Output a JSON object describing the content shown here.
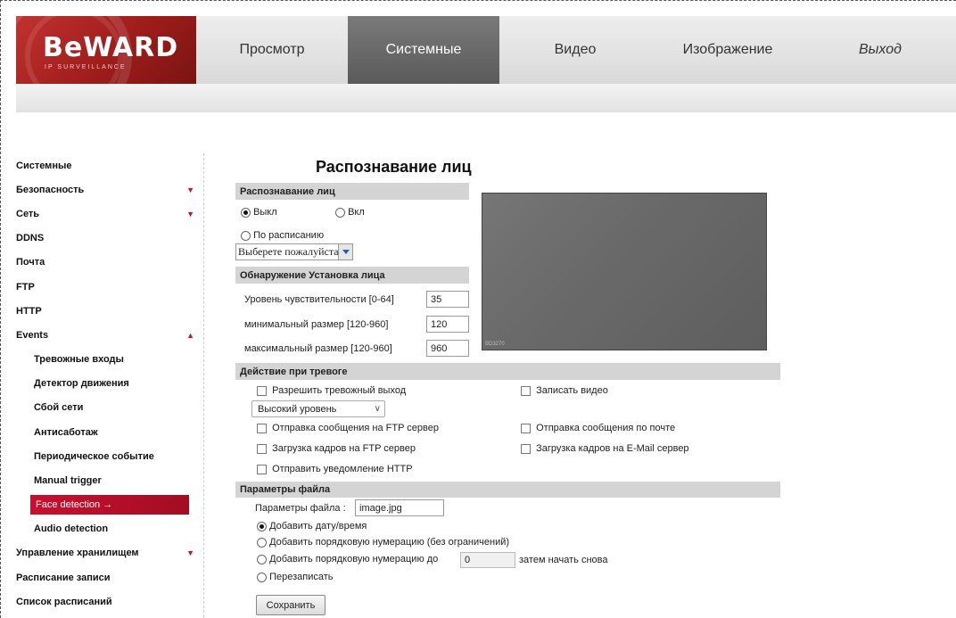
{
  "logo": {
    "brand": "BeWARD",
    "tagline": "IP SURVEILLANCE"
  },
  "topnav": [
    {
      "label": "Просмотр",
      "active": false
    },
    {
      "label": "Системные",
      "active": true
    },
    {
      "label": "Видео",
      "active": false
    },
    {
      "label": "Изображение",
      "active": false
    },
    {
      "label": "Выход",
      "active": false
    }
  ],
  "sidebar": {
    "items": [
      {
        "label": "Системные"
      },
      {
        "label": "Безопасность"
      },
      {
        "label": "Сеть"
      },
      {
        "label": "DDNS"
      },
      {
        "label": "Почта"
      },
      {
        "label": "FTP"
      },
      {
        "label": "HTTP"
      },
      {
        "label": "Events"
      },
      {
        "label": "Тревожные входы"
      },
      {
        "label": "Детектор движения"
      },
      {
        "label": "Сбой сети"
      },
      {
        "label": "Антисаботаж"
      },
      {
        "label": "Периодическое событие"
      },
      {
        "label": "Manual trigger"
      },
      {
        "label": "Face detection →"
      },
      {
        "label": "Audio detection"
      },
      {
        "label": "Управление хранилищем"
      },
      {
        "label": "Расписание записи"
      },
      {
        "label": "Список расписаний"
      }
    ],
    "arrow_down": "▼",
    "arrow_up": "▲"
  },
  "main": {
    "title": "Распознавание лиц",
    "section_face": {
      "header": "Распознавание лиц",
      "off_label": "Выкл",
      "on_label": "Вкл",
      "schedule_label": "По расписанию",
      "schedule_select": "Выберете пожалуйста..."
    },
    "section_detect": {
      "header": "Обнаружение Установка лица",
      "sensitivity_label": "Уровень чувствительности [0-64]",
      "sensitivity_value": "35",
      "min_label": "минимальный размер [120-960]",
      "min_value": "120",
      "max_label": "максимальный размер [120-960]",
      "max_value": "960"
    },
    "preview": {
      "camera_label": "BD3270"
    },
    "section_action": {
      "header": "Действие при тревоге",
      "alarm_out": "Разрешить тревожный выход",
      "level_select": "Высокий уровень",
      "record_video": "Записать видео",
      "ftp_message": "Отправка сообщения на FTP сервер",
      "mail_message": "Отправка сообщения по почте",
      "ftp_frames": "Загрузка кадров на FTP сервер",
      "mail_frames": "Загрузка кадров на E-Mail сервер",
      "http_notify": "Отправить уведомление HTTP"
    },
    "section_file": {
      "header": "Параметры файла",
      "file_label": "Параметры файла :",
      "file_value": "image.jpg",
      "opt_datetime": "Добавить дату/время",
      "opt_seq_unlimited": "Добавить порядковую нумерацию (без ограничений)",
      "opt_seq_upto": "Добавить порядковую нумерацию до",
      "seq_upto_value": "0",
      "restart_label": "затем начать снова",
      "opt_overwrite": "Перезаписать"
    },
    "save_button": "Сохранить"
  }
}
